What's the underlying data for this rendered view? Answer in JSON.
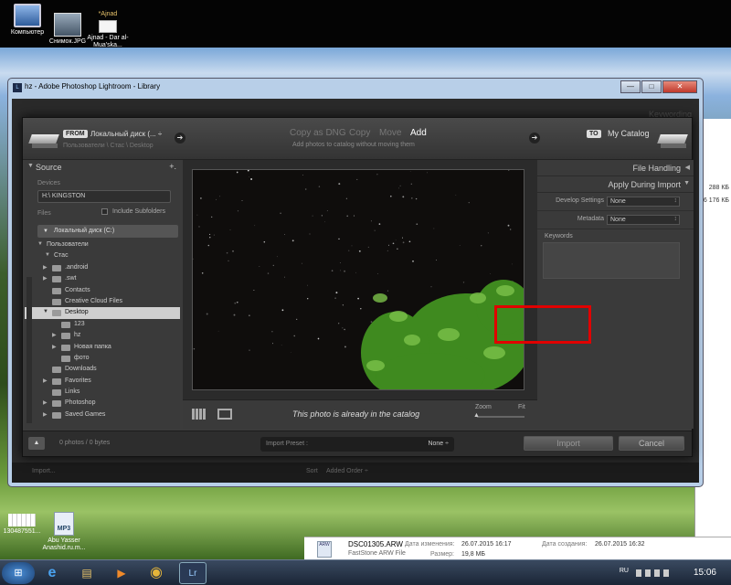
{
  "desktop_icons": [
    {
      "label": "Компьютер",
      "icon": "computer-icon"
    },
    {
      "label": "Снимок.JPG",
      "icon": "image-file-icon"
    },
    {
      "label": "*Ajnad",
      "icon": "folder-icon"
    },
    {
      "label": "Ajnad - Dar al-Mua'ska...",
      "icon": "document-icon"
    },
    {
      "label": "130487551...",
      "icon": "image-file-icon"
    },
    {
      "label": "Abu Yasser Anashid.ru.m...",
      "icon": "mp3-file-icon"
    }
  ],
  "lr_window": {
    "title": "hz - Adobe Photoshop Lightroom - Library",
    "app_badge": "L",
    "btn_minimize": "—",
    "btn_maximize": "□",
    "btn_close": "✕",
    "bg_import": "Import...",
    "bg_sort_label": "Sort",
    "bg_sort_value": "Added Order ÷",
    "bg_keywording": "Keywording"
  },
  "import_dialog": {
    "from_tag": "FROM",
    "from_source": "Локальный диск (... ÷",
    "from_path": "Пользователи \\ Стас \\ Desktop",
    "modes": [
      "Copy as DNG",
      "Copy",
      "Move",
      "Add"
    ],
    "active_mode": "Add",
    "mode_description": "Add photos to catalog without moving them",
    "to_tag": "TO",
    "to_catalog": "My Catalog",
    "source_panel": {
      "title": "Source",
      "plus": "+.",
      "devices_label": "Devices",
      "device": "H:\\ KINGSTON",
      "files_label": "Files",
      "include_subfolders": "Include Subfolders",
      "drive": "Локальный диск (C:)",
      "tree": [
        {
          "label": "Пользователи",
          "level": 0,
          "expand": "open"
        },
        {
          "label": "Стас",
          "level": 1,
          "expand": "open"
        },
        {
          "label": ".android",
          "level": 2,
          "expand": "closed"
        },
        {
          "label": ".swt",
          "level": 2,
          "expand": "closed"
        },
        {
          "label": "Contacts",
          "level": 2,
          "expand": ""
        },
        {
          "label": "Creative Cloud Files",
          "level": 2,
          "expand": ""
        },
        {
          "label": "Desktop",
          "level": 2,
          "expand": "open",
          "selected": true
        },
        {
          "label": "123",
          "level": 3,
          "expand": ""
        },
        {
          "label": "hz",
          "level": 3,
          "expand": "closed"
        },
        {
          "label": "Новая папка",
          "level": 3,
          "expand": "closed"
        },
        {
          "label": "фото",
          "level": 3,
          "expand": ""
        },
        {
          "label": "Downloads",
          "level": 2,
          "expand": ""
        },
        {
          "label": "Favorites",
          "level": 2,
          "expand": "closed"
        },
        {
          "label": "Links",
          "level": 2,
          "expand": ""
        },
        {
          "label": "Photoshop",
          "level": 2,
          "expand": "closed"
        },
        {
          "label": "Saved Games",
          "level": 2,
          "expand": "closed"
        }
      ]
    },
    "center": {
      "status": "This photo is already in the catalog",
      "zoom_label": "Zoom",
      "fit_label": "Fit"
    },
    "right_panel": {
      "file_handling": "File Handling",
      "apply_during_import": "Apply During Import",
      "develop_settings_label": "Develop Settings",
      "develop_settings_value": "None",
      "metadata_label": "Metadata",
      "metadata_value": "None",
      "keywords_label": "Keywords"
    },
    "footer": {
      "photo_count": "0 photos / 0 bytes",
      "preset_label": "Import Preset :",
      "preset_value": "None ÷",
      "import_button": "Import",
      "cancel_button": "Cancel"
    }
  },
  "explorer": {
    "size_1": "288 КБ",
    "size_2": "6 176 КБ",
    "file_badge": "ARW",
    "file_name": "DSC01305.ARW",
    "file_type": "FastStone ARW File",
    "modified_label": "Дата изменения:",
    "modified_value": "26.07.2015 16:17",
    "created_label": "Дата создания:",
    "created_value": "26.07.2015 16:32",
    "size_label": "Размер:",
    "size_value": "19,8 МБ"
  },
  "taskbar": {
    "start_glyph": "⊞",
    "apps": [
      {
        "name": "internet-explorer",
        "glyph": "e"
      },
      {
        "name": "file-explorer",
        "glyph": "▤"
      },
      {
        "name": "media-player",
        "glyph": "▶"
      },
      {
        "name": "chrome",
        "glyph": "◉"
      },
      {
        "name": "lightroom",
        "glyph": "Lr"
      }
    ],
    "language": "RU",
    "clock": "15:06"
  }
}
